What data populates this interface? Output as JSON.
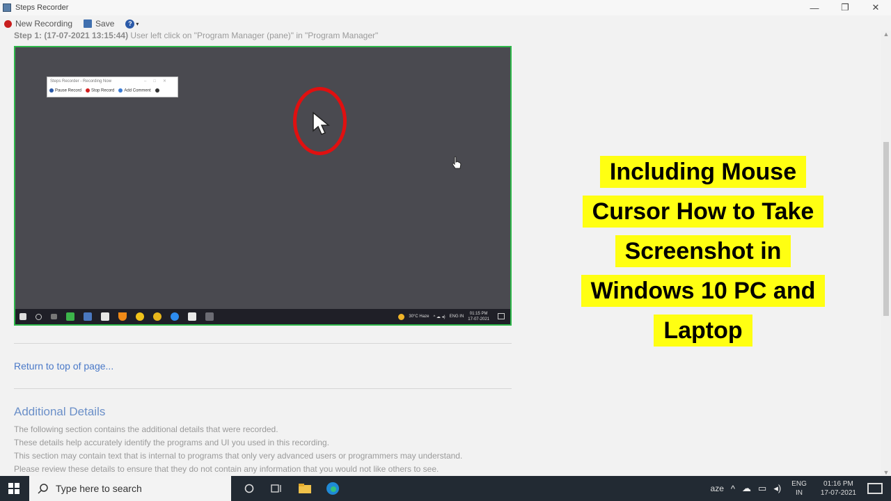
{
  "window": {
    "title": "Steps Recorder",
    "controls": [
      "—",
      "❐",
      "✕"
    ]
  },
  "toolbar": {
    "new_recording": "New Recording",
    "save": "Save",
    "help_caret": "▾"
  },
  "step": {
    "label": "Step 1: (17-07-2021 13:15:44)",
    "text": " User left click on \"Program Manager (pane)\" in \"Program Manager\""
  },
  "screenshot": {
    "mini_title": "Steps Recorder - Recording Now",
    "mini_pause": "Pause Record",
    "mini_stop": "Stop Record",
    "mini_comment": "Add Comment",
    "tray_weather": "30°C Haze",
    "tray_lang": "ENG IN",
    "tray_time": "01:15 PM",
    "tray_date": "17-07-2021"
  },
  "report": {
    "return_link": "Return to top of page...",
    "additional_heading": "Additional Details",
    "lines": [
      "The following section contains the additional details that were recorded.",
      "These details help accurately identify the programs and UI you used in this recording.",
      "This section may contain text that is internal to programs that only very advanced users or programmers may understand.",
      "Please review these details to ensure that they do not contain any information that you would not like others to see."
    ]
  },
  "headline": {
    "lines": [
      "Including Mouse",
      "Cursor How to Take",
      "Screenshot in",
      "Windows 10 PC and",
      "Laptop"
    ]
  },
  "taskbar": {
    "search_placeholder": "Type here to search",
    "weather_fragment": "aze",
    "lang_top": "ENG",
    "lang_bottom": "IN",
    "time": "01:16 PM",
    "date": "17-07-2021"
  },
  "colors": {
    "highlight_yellow": "#ffff12",
    "frame_green": "#2fb84b",
    "ring_red": "#e01010",
    "link_blue": "#4a79c8"
  }
}
